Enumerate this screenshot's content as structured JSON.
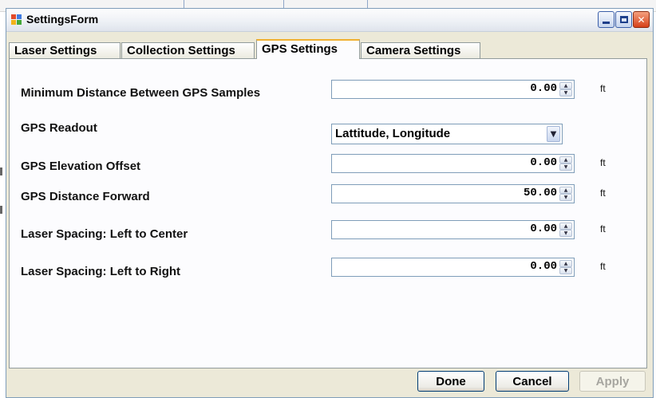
{
  "window": {
    "title": "SettingsForm",
    "controls": {
      "minimize": "minimize",
      "maximize": "maximize",
      "close": "✕"
    }
  },
  "tabs": [
    {
      "label": "Laser Settings",
      "active": false
    },
    {
      "label": "Collection Settings",
      "active": false
    },
    {
      "label": "GPS Settings",
      "active": true
    },
    {
      "label": "Camera Settings",
      "active": false
    }
  ],
  "fields": {
    "min_distance": {
      "label": "Minimum Distance Between GPS Samples",
      "value": "0.00",
      "unit": "ft"
    },
    "gps_readout": {
      "label": "GPS Readout",
      "value": "Lattitude, Longitude"
    },
    "elevation_offset": {
      "label": "GPS Elevation Offset",
      "value": "0.00",
      "unit": "ft"
    },
    "distance_forward": {
      "label": "GPS Distance Forward",
      "value": "50.00",
      "unit": "ft"
    },
    "laser_left_center": {
      "label": "Laser Spacing: Left to Center",
      "value": "0.00",
      "unit": "ft"
    },
    "laser_left_right": {
      "label": "Laser Spacing: Left to Right",
      "value": "0.00",
      "unit": "ft"
    }
  },
  "buttons": {
    "done": "Done",
    "cancel": "Cancel",
    "apply": "Apply"
  },
  "colors": {
    "window_frame": "#7f9db9",
    "close_red": "#d6401a",
    "active_tab_accent": "#f0b030"
  }
}
